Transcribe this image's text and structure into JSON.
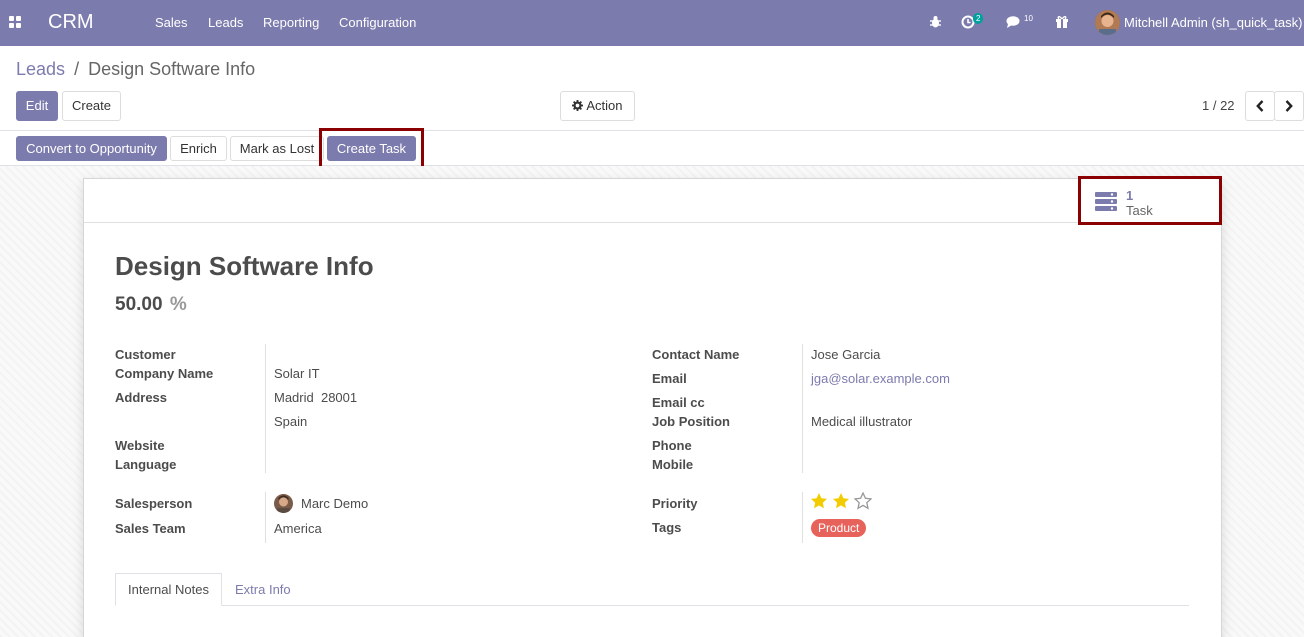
{
  "navbar": {
    "app_name": "CRM",
    "menu": [
      "Sales",
      "Leads",
      "Reporting",
      "Configuration"
    ],
    "activity_count": "2",
    "messages_count": "10",
    "user": "Mitchell Admin (sh_quick_task)",
    "icons": [
      "apps-icon",
      "bug-icon",
      "clock-icon",
      "chat-icon",
      "gift-icon"
    ]
  },
  "breadcrumb": {
    "parent": "Leads",
    "separator": "/",
    "current": "Design Software Info"
  },
  "controls": {
    "edit": "Edit",
    "create": "Create",
    "action": "Action",
    "pager": "1 / 22"
  },
  "statusbar": {
    "convert": "Convert to Opportunity",
    "enrich": "Enrich",
    "mark_lost": "Mark as Lost",
    "create_task": "Create Task"
  },
  "smart_button": {
    "count": "1",
    "label": "Task"
  },
  "lead": {
    "name": "Design Software Info",
    "probability": "50.00",
    "probability_unit": "%",
    "left": {
      "customer_label": "Customer",
      "company_label": "Company Name",
      "company": "Solar IT",
      "address_label": "Address",
      "address_line1": "Madrid  28001",
      "address_line2": "Spain",
      "website_label": "Website",
      "language_label": "Language",
      "salesperson_label": "Salesperson",
      "salesperson": "Marc Demo",
      "team_label": "Sales Team",
      "team": "America"
    },
    "right": {
      "contact_label": "Contact Name",
      "contact": "Jose Garcia",
      "email_label": "Email",
      "email": "jga@solar.example.com",
      "email_cc_label": "Email cc",
      "job_label": "Job Position",
      "job": "Medical illustrator",
      "phone_label": "Phone",
      "mobile_label": "Mobile",
      "priority_label": "Priority",
      "priority": 2,
      "priority_max": 3,
      "tags_label": "Tags",
      "tag": "Product",
      "tag_color": "#e8625c"
    }
  },
  "tabs": {
    "internal_notes": "Internal Notes",
    "extra_info": "Extra Info"
  },
  "colors": {
    "brand": "#7c7bad",
    "highlight": "#8b0000",
    "star": "#f3cc00"
  }
}
